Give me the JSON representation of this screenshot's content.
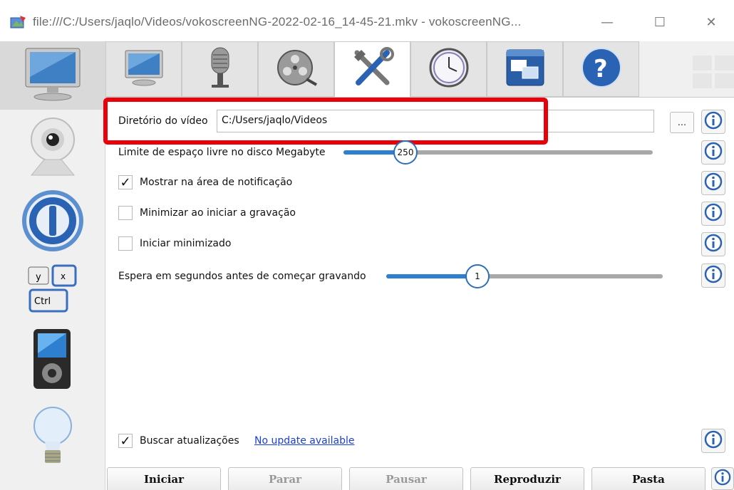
{
  "window": {
    "title": "file:///C:/Users/jaqlo/Videos/vokoscreenNG-2022-02-16_14-45-21.mkv - vokoscreenNG...",
    "minimize_glyph": "—",
    "maximize_glyph": "☐",
    "close_glyph": "✕"
  },
  "sidebar": {
    "items": [
      {
        "name": "screen",
        "icon": "monitor-icon"
      },
      {
        "name": "camera",
        "icon": "webcam-icon"
      },
      {
        "name": "player",
        "icon": "power-ring-icon"
      },
      {
        "name": "shortcuts",
        "icon": "keyboard-shortcut-icon",
        "keys": [
          "y",
          "x",
          "Ctrl"
        ]
      },
      {
        "name": "media-player",
        "icon": "media-player-icon"
      },
      {
        "name": "log",
        "icon": "lightbulb-icon"
      }
    ]
  },
  "tabs": [
    {
      "name": "screen",
      "icon": "monitor-icon"
    },
    {
      "name": "audio",
      "icon": "microphone-icon"
    },
    {
      "name": "codec",
      "icon": "film-reel-icon"
    },
    {
      "name": "settings",
      "icon": "tools-icon",
      "active": true
    },
    {
      "name": "timer",
      "icon": "clock-icon"
    },
    {
      "name": "window",
      "icon": "window-icon"
    },
    {
      "name": "help",
      "icon": "help-icon"
    }
  ],
  "settings": {
    "video_dir_label": "Diretório do vídeo",
    "video_dir_value": "C:/Users/jaqlo/Videos",
    "browse_label": "...",
    "disk_limit_label": "Limite de espaço livre no disco Megabyte",
    "disk_limit_value": "250",
    "disk_limit_fraction": 0.2,
    "show_tray_label": "Mostrar na área de notificação",
    "show_tray_checked": true,
    "check_mark": "✓",
    "minimize_on_record_label": "Minimizar ao iniciar a gravação",
    "minimize_on_record_checked": false,
    "start_minimized_label": "Iniciar minimizado",
    "start_minimized_checked": false,
    "delay_label": "Espera em segundos antes de começar gravando",
    "delay_value": "1",
    "delay_fraction": 0.33,
    "updates_label": "Buscar atualizações",
    "updates_checked": true,
    "updates_status": "No update available"
  },
  "buttons": {
    "start": "Iniciar",
    "stop": "Parar",
    "pause": "Pausar",
    "play": "Reproduzir",
    "folder": "Pasta"
  },
  "colors": {
    "highlight": "#e8000b",
    "accent": "#2e7fd0",
    "link": "#1a3fd6"
  }
}
